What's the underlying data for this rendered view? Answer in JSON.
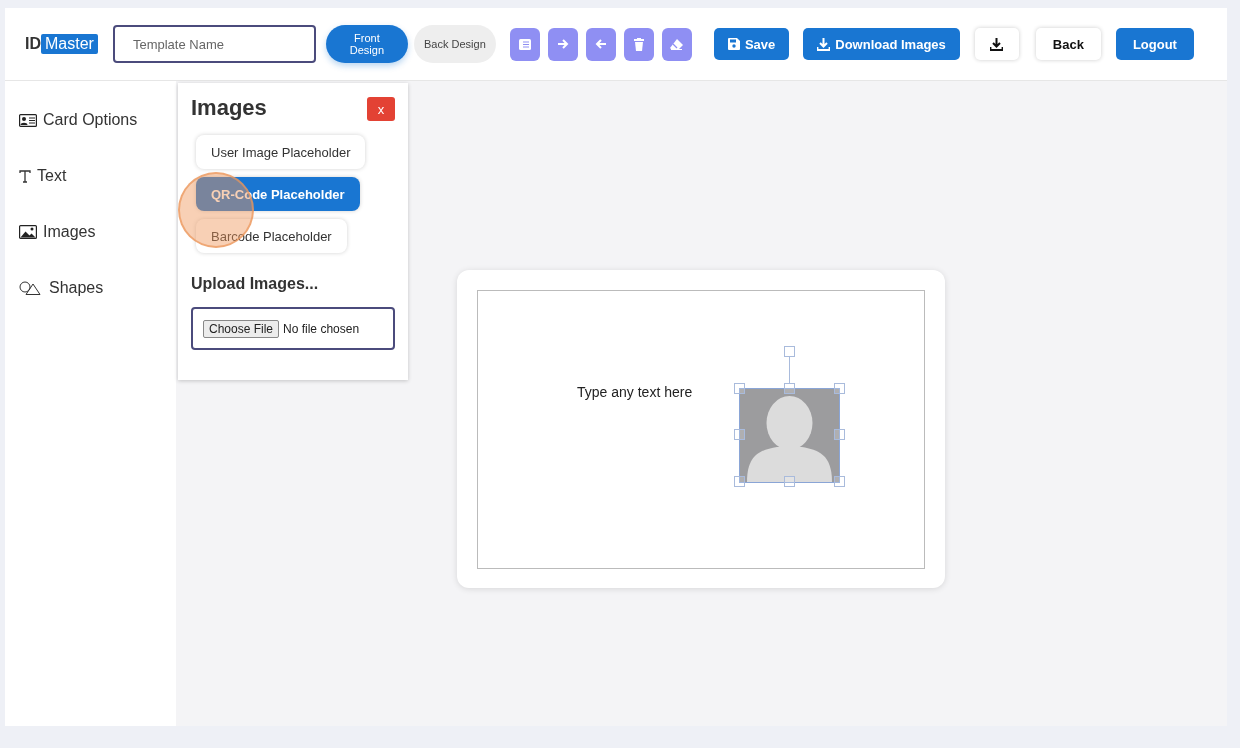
{
  "logo": {
    "prefix": "ID",
    "highlight": "Master"
  },
  "template_name": {
    "placeholder": "Template Name"
  },
  "design_tabs": [
    {
      "label": "Front Design",
      "selected": true
    },
    {
      "label": "Back Design",
      "selected": false
    }
  ],
  "tool_buttons": [
    {
      "kind": "list"
    },
    {
      "kind": "forward"
    },
    {
      "kind": "backward"
    },
    {
      "kind": "delete"
    },
    {
      "kind": "erase"
    }
  ],
  "actions": [
    {
      "kind": "save",
      "label": "Save"
    },
    {
      "kind": "download",
      "label": "Download Images"
    },
    {
      "kind": "download-icon"
    },
    {
      "kind": "back",
      "label": "Back"
    },
    {
      "kind": "logout",
      "label": "Logout"
    }
  ],
  "sidebar": {
    "items": [
      {
        "kind": "card",
        "label": "Card Options"
      },
      {
        "kind": "text",
        "label": "Text"
      },
      {
        "kind": "images",
        "label": "Images"
      },
      {
        "kind": "shapes",
        "label": "Shapes"
      }
    ]
  },
  "images_panel": {
    "title": "Images",
    "close": "x",
    "placeholders": [
      {
        "label": "User Image Placeholder",
        "selected": false
      },
      {
        "label": "QR-Code Placeholder",
        "selected": true
      },
      {
        "label": "Barcode Placeholder",
        "selected": false
      }
    ],
    "upload_heading": "Upload Images...",
    "file_input": {
      "button": "Choose File",
      "status": "No file chosen"
    }
  },
  "canvas": {
    "text": "Type any text here",
    "image": {
      "kind": "user-placeholder",
      "selected": true
    }
  }
}
